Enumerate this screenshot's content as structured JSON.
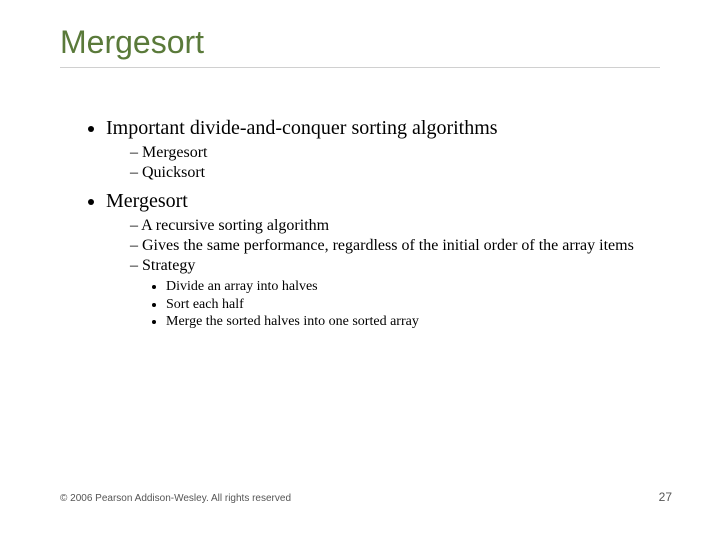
{
  "title": "Mergesort",
  "bullets": {
    "b1": "Important divide-and-conquer sorting algorithms",
    "b1_sub": {
      "s1": "Mergesort",
      "s2": "Quicksort"
    },
    "b2": "Mergesort",
    "b2_sub": {
      "s1": "A recursive sorting algorithm",
      "s2": "Gives the same performance, regardless of the initial order of the array items",
      "s3": "Strategy",
      "s3_sub": {
        "t1": "Divide an array into halves",
        "t2": "Sort each half",
        "t3": "Merge the sorted halves into one sorted array"
      }
    }
  },
  "footer": {
    "copyright": "© 2006 Pearson Addison-Wesley. All rights reserved",
    "page": "27"
  }
}
